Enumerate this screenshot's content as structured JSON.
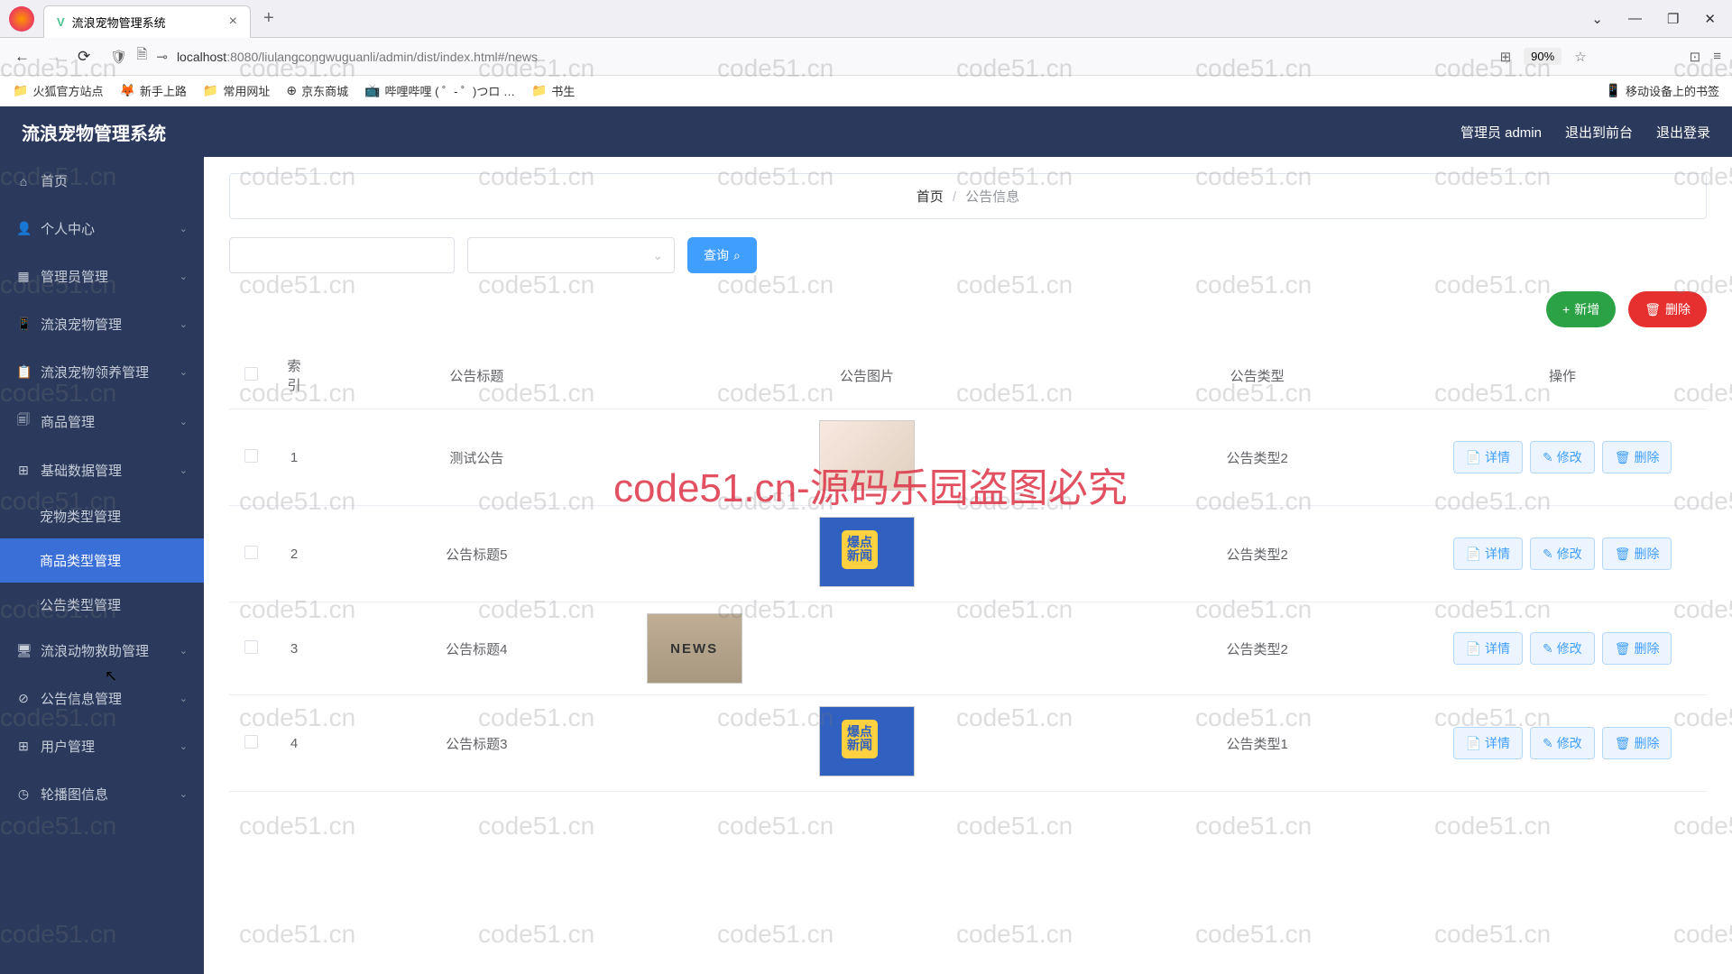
{
  "browser": {
    "tab_title": "流浪宠物管理系统",
    "url_host": "localhost",
    "url_port": ":8080",
    "url_path": "/liulangcongwuguanli/admin/dist/index.html#/news",
    "zoom": "90%",
    "bookmarks": [
      {
        "icon": "📁",
        "label": "火狐官方站点"
      },
      {
        "icon": "🦊",
        "label": "新手上路"
      },
      {
        "icon": "📁",
        "label": "常用网址"
      },
      {
        "icon": "⊕",
        "label": "京东商城"
      },
      {
        "icon": "📺",
        "label": "哔哩哔哩 ( ゜- ゜)つロ …"
      },
      {
        "icon": "📁",
        "label": "书生"
      }
    ],
    "mobile_bookmarks": "移动设备上的书签"
  },
  "app": {
    "title": "流浪宠物管理系统",
    "header": {
      "admin": "管理员 admin",
      "logout_front": "退出到前台",
      "logout": "退出登录"
    }
  },
  "sidebar": {
    "items": [
      {
        "icon": "⌂",
        "label": "首页",
        "expandable": false
      },
      {
        "icon": "👤",
        "label": "个人中心",
        "expandable": true
      },
      {
        "icon": "▦",
        "label": "管理员管理",
        "expandable": true
      },
      {
        "icon": "📱",
        "label": "流浪宠物管理",
        "expandable": true
      },
      {
        "icon": "📋",
        "label": "流浪宠物领养管理",
        "expandable": true
      },
      {
        "icon": "🗐",
        "label": "商品管理",
        "expandable": true
      },
      {
        "icon": "⊞",
        "label": "基础数据管理",
        "expandable": true,
        "expanded": true,
        "children": [
          {
            "label": "宠物类型管理",
            "active": false
          },
          {
            "label": "商品类型管理",
            "active": true
          },
          {
            "label": "公告类型管理",
            "active": false
          }
        ]
      },
      {
        "icon": "🖥",
        "label": "流浪动物救助管理",
        "expandable": true
      },
      {
        "icon": "⊘",
        "label": "公告信息管理",
        "expandable": true
      },
      {
        "icon": "⊞",
        "label": "用户管理",
        "expandable": true
      },
      {
        "icon": "◷",
        "label": "轮播图信息",
        "expandable": true
      }
    ]
  },
  "breadcrumb": {
    "home": "首页",
    "current": "公告信息"
  },
  "toolbar": {
    "search_btn": "查询",
    "add_btn": "新增",
    "delete_btn": "删除"
  },
  "table": {
    "headers": {
      "index": "索引",
      "title": "公告标题",
      "image": "公告图片",
      "type": "公告类型",
      "ops": "操作"
    },
    "rows": [
      {
        "idx": "1",
        "title": "测试公告",
        "type": "公告类型2",
        "thumb": "t1"
      },
      {
        "idx": "2",
        "title": "公告标题5",
        "type": "公告类型2",
        "thumb": "t2"
      },
      {
        "idx": "3",
        "title": "公告标题4",
        "type": "公告类型2",
        "thumb": "t3",
        "thumb_text": "NEWS"
      },
      {
        "idx": "4",
        "title": "公告标题3",
        "type": "公告类型1",
        "thumb": "t2"
      }
    ],
    "row_ops": {
      "detail": "详情",
      "edit": "修改",
      "del": "删除"
    }
  },
  "watermark": {
    "text": "code51.cn",
    "big": "code51.cn-源码乐园盗图必究"
  }
}
